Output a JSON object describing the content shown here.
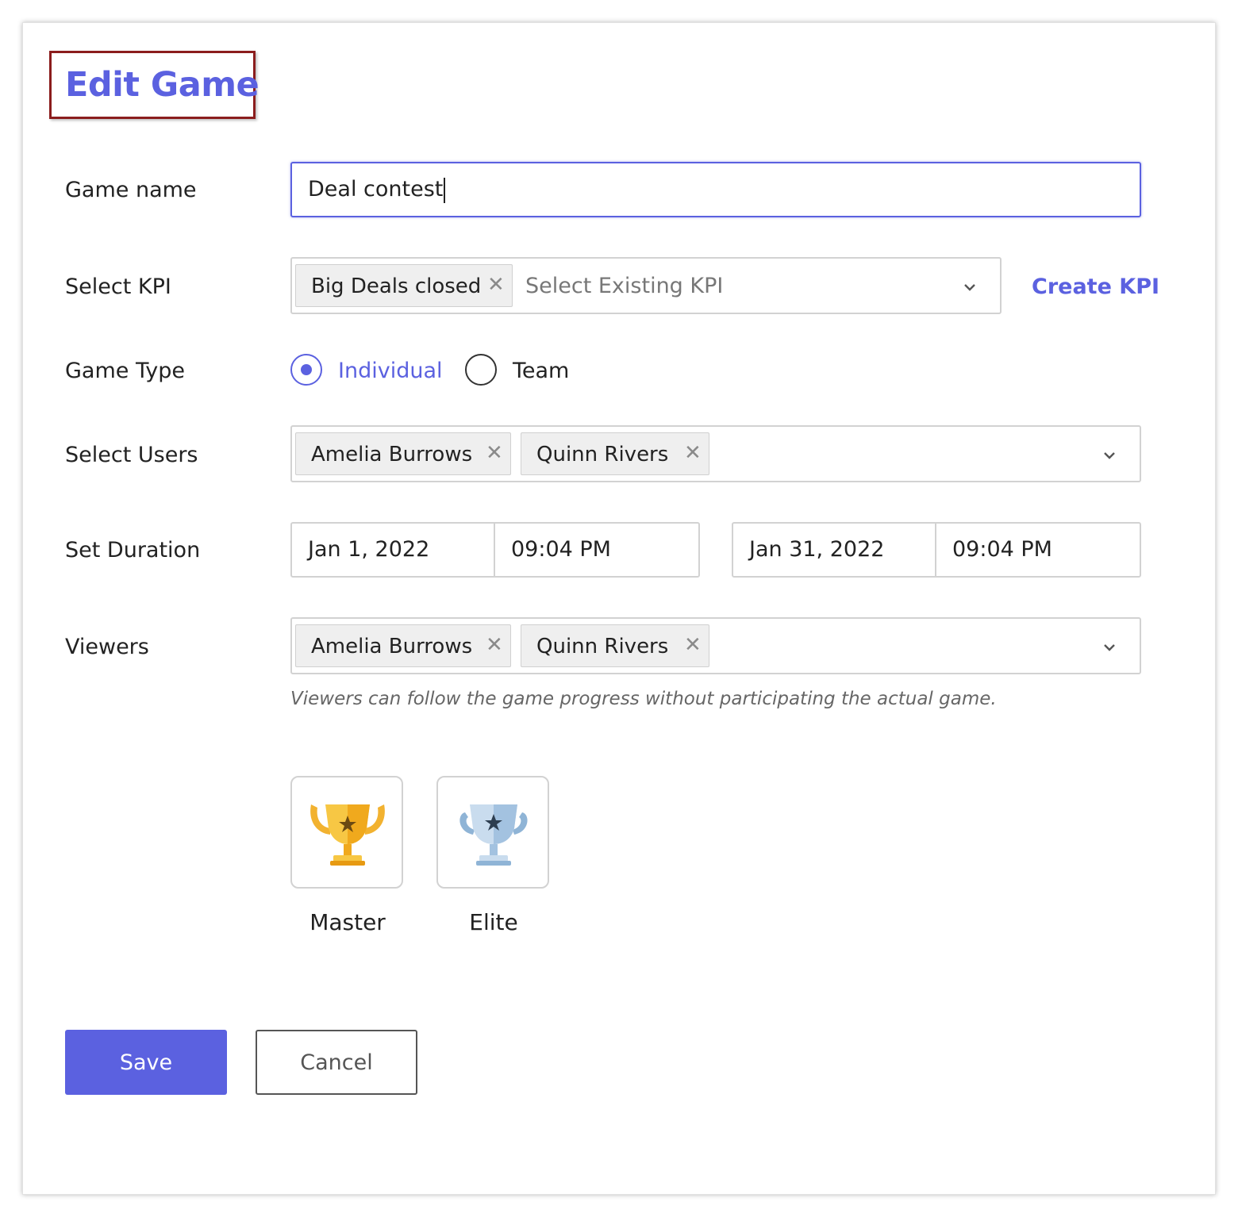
{
  "header": {
    "title": "Edit Game"
  },
  "game_name": {
    "label": "Game name",
    "value": "Deal contest"
  },
  "kpi": {
    "label": "Select KPI",
    "chips": [
      "Big Deals closed"
    ],
    "placeholder": "Select Existing KPI",
    "create_link": "Create KPI"
  },
  "game_type": {
    "label": "Game Type",
    "options": [
      {
        "label": "Individual",
        "selected": true
      },
      {
        "label": "Team",
        "selected": false
      }
    ]
  },
  "users": {
    "label": "Select Users",
    "chips": [
      "Amelia Burrows",
      "Quinn Rivers"
    ]
  },
  "duration": {
    "label": "Set Duration",
    "start_date": "Jan 1, 2022",
    "start_time": "09:04 PM",
    "end_date": "Jan 31, 2022",
    "end_time": "09:04 PM"
  },
  "viewers": {
    "label": "Viewers",
    "chips": [
      "Amelia Burrows",
      "Quinn Rivers"
    ],
    "hint": "Viewers can follow the game progress without participating the actual game."
  },
  "badges": [
    {
      "label": "Master",
      "icon": "gold-trophy-icon"
    },
    {
      "label": "Elite",
      "icon": "silver-trophy-icon"
    }
  ],
  "actions": {
    "save_label": "Save",
    "cancel_label": "Cancel"
  },
  "colors": {
    "accent": "#5b61e0",
    "title_frame": "#8b1d1d"
  }
}
